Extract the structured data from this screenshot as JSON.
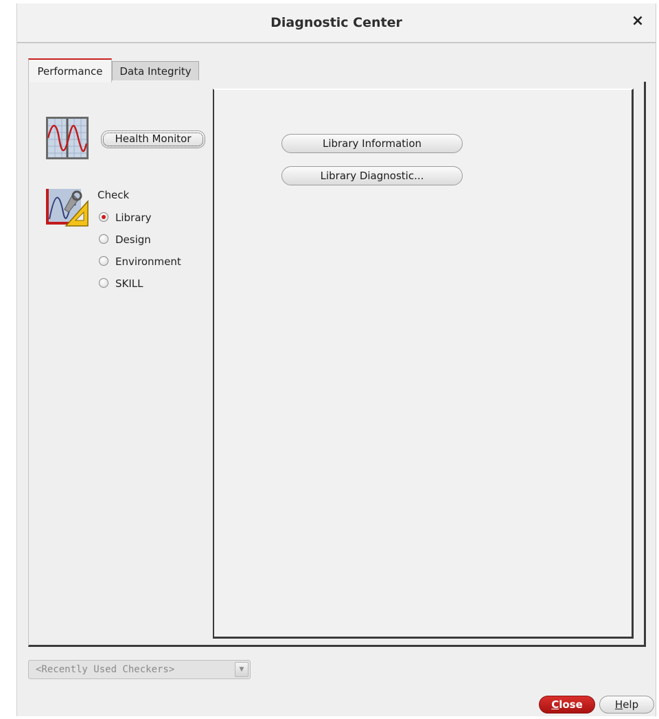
{
  "window": {
    "title": "Diagnostic Center",
    "close_glyph": "×"
  },
  "tabs": [
    {
      "label": "Performance",
      "active": true
    },
    {
      "label": "Data Integrity",
      "active": false
    }
  ],
  "left": {
    "health_monitor_icon": "waveform-monitor-icon",
    "health_monitor_label": "Health Monitor",
    "check_icon": "waveform-tools-icon",
    "check_label": "Check",
    "options": [
      {
        "label": "Library",
        "selected": true
      },
      {
        "label": "Design",
        "selected": false
      },
      {
        "label": "Environment",
        "selected": false
      },
      {
        "label": "SKILL",
        "selected": false
      }
    ]
  },
  "right": {
    "buttons": [
      {
        "label": "Library Information"
      },
      {
        "label": "Library Diagnostic..."
      }
    ]
  },
  "bottom": {
    "recent_checkers": "<Recently Used Checkers>",
    "close_first": "C",
    "close_rest": "lose",
    "help_first": "H",
    "help_rest": "elp"
  },
  "colors": {
    "accent_red": "#c91e1e",
    "window_bg": "#efefef"
  }
}
